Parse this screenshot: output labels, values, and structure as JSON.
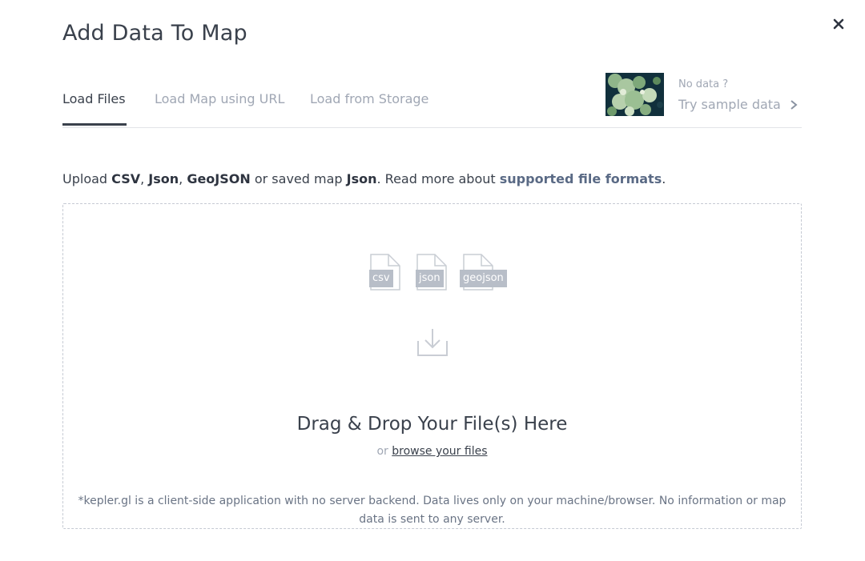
{
  "modal": {
    "title": "Add Data To Map",
    "close_icon": "close-icon"
  },
  "tabs": [
    {
      "label": "Load Files",
      "active": true
    },
    {
      "label": "Load Map using URL",
      "active": false
    },
    {
      "label": "Load from Storage",
      "active": false
    }
  ],
  "sample": {
    "no_data": "No data ?",
    "try_label": "Try sample data",
    "chevron_icon": "chevron-right-icon",
    "thumbnail": "sample-map-thumbnail"
  },
  "upload": {
    "prefix": "Upload ",
    "csv": "CSV",
    "sep1": ", ",
    "json": "Json",
    "sep2": ", ",
    "geojson": "GeoJSON",
    "middle": " or saved map ",
    "map_json": "Json",
    "read_more": ". Read more about ",
    "formats_link": "supported file formats",
    "suffix": "."
  },
  "dropzone": {
    "file_badges": [
      "csv",
      "json",
      "geojson"
    ],
    "download_icon": "download-tray-icon",
    "title": "Drag & Drop Your File(s) Here",
    "or_text": "or ",
    "browse_link": "browse your files",
    "disclaimer": "*kepler.gl is a client-side application with no server backend. Data lives only on your machine/browser. No information or map data is sent to any server."
  },
  "colors": {
    "text_primary": "#3a414c",
    "text_muted": "#a0a7b4",
    "border": "#c5cad3",
    "badge": "#b8bec8"
  }
}
